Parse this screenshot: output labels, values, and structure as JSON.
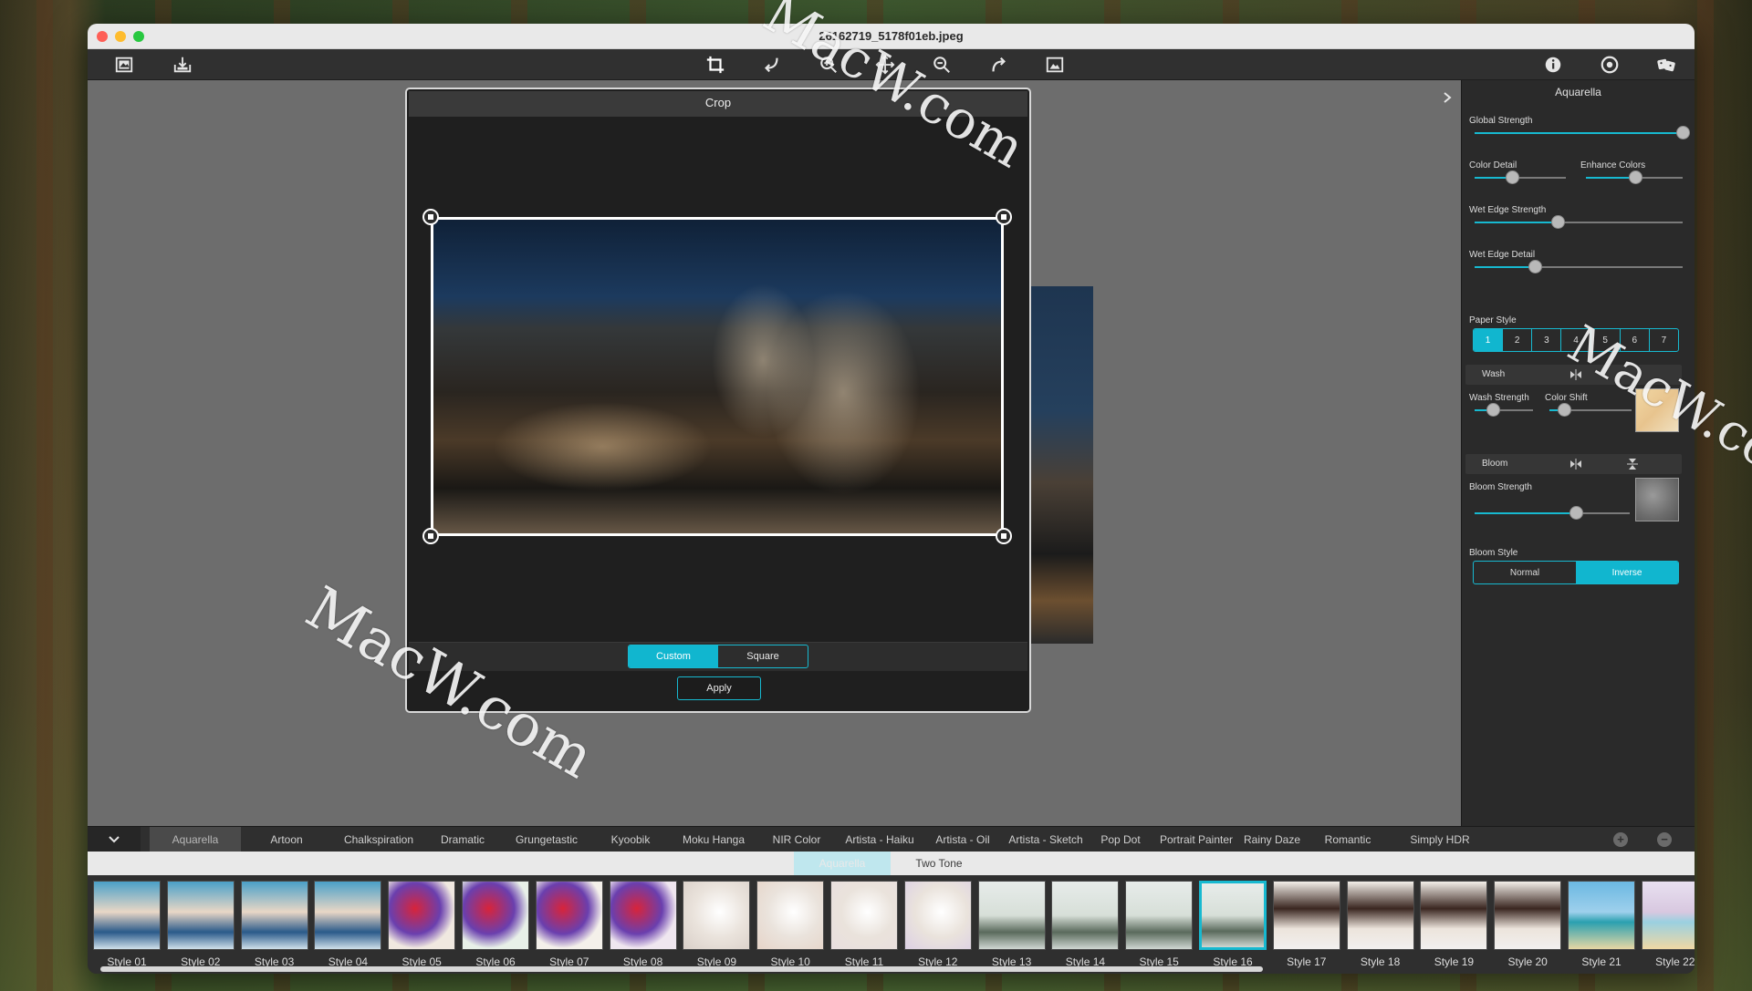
{
  "window": {
    "title": "26162719_5178f01eb.jpeg"
  },
  "toolbar": {
    "left_icons": [
      "open-image-icon",
      "export-icon"
    ],
    "center_icons": [
      "crop-icon",
      "undo-icon",
      "zoom-in-icon",
      "pan-icon",
      "zoom-out-icon",
      "redo-icon",
      "compare-icon"
    ],
    "right_icons": [
      "info-icon",
      "preferences-icon",
      "random-style-icon"
    ]
  },
  "crop": {
    "title": "Crop",
    "mode_custom": "Custom",
    "mode_square": "Square",
    "active_mode": "Custom",
    "apply_label": "Apply"
  },
  "panel": {
    "title": "Aquarella",
    "global_strength_label": "Global Strength",
    "global_strength_value": 1.0,
    "color_detail_label": "Color Detail",
    "color_detail_value": 0.41,
    "enhance_colors_label": "Enhance Colors",
    "enhance_colors_value": 0.51,
    "wet_edge_strength_label": "Wet Edge Strength",
    "wet_edge_strength_value": 0.4,
    "wet_edge_detail_label": "Wet Edge Detail",
    "wet_edge_detail_value": 0.29,
    "paper_style_label": "Paper Style",
    "paper_styles": [
      "1",
      "2",
      "3",
      "4",
      "5",
      "6",
      "7"
    ],
    "paper_style_active": "1",
    "wash_label": "Wash",
    "wash_strength_label": "Wash Strength",
    "wash_strength_value": 0.32,
    "color_shift_label": "Color Shift",
    "color_shift_value": 0.18,
    "bloom_label": "Bloom",
    "bloom_strength_label": "Bloom Strength",
    "bloom_strength_value": 0.65,
    "bloom_style_label": "Bloom Style",
    "bloom_style_normal": "Normal",
    "bloom_style_inverse": "Inverse",
    "bloom_style_active": "Inverse"
  },
  "categories": {
    "tabs": [
      "Aquarella",
      "Artoon",
      "Chalkspiration",
      "Dramatic",
      "Grungetastic",
      "Kyoobik",
      "Moku Hanga",
      "NIR Color",
      "Artista - Haiku",
      "Artista - Oil",
      "Artista - Sketch",
      "Pop Dot",
      "Portrait Painter",
      "Rainy Daze",
      "Romantic",
      "Simply HDR"
    ],
    "active": "Aquarella",
    "add_symbol": "+",
    "remove_symbol": "−"
  },
  "subcategories": {
    "tabs": [
      "Aquarella",
      "Two Tone"
    ],
    "active": "Aquarella"
  },
  "styles": {
    "items": [
      "Style 01",
      "Style 02",
      "Style 03",
      "Style 04",
      "Style 05",
      "Style 06",
      "Style 07",
      "Style 08",
      "Style 09",
      "Style 10",
      "Style 11",
      "Style 12",
      "Style 13",
      "Style 14",
      "Style 15",
      "Style 16",
      "Style 17",
      "Style 18",
      "Style 19",
      "Style 20",
      "Style 21",
      "Style 22"
    ],
    "selected": "Style 16"
  },
  "watermark": {
    "text": "MacW.com"
  },
  "colors": {
    "accent": "#17b9d0",
    "panel_bg": "#2a2a2a",
    "canvas_bg": "#6d6d6d"
  }
}
